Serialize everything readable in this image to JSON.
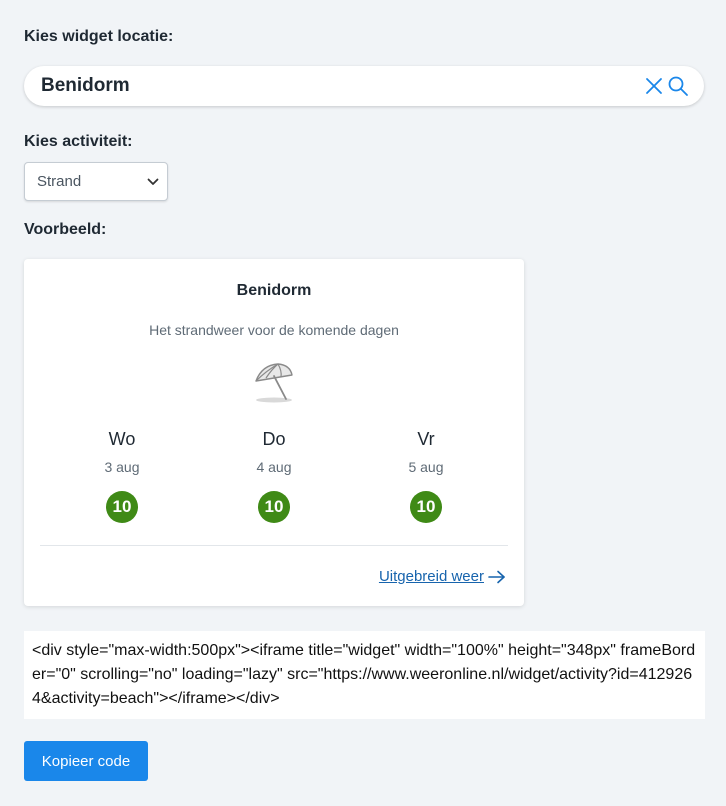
{
  "location": {
    "label": "Kies widget locatie:",
    "value": "Benidorm",
    "clear_icon": "close-icon",
    "search_icon": "search-icon",
    "accent_color": "#1a87ea"
  },
  "activity": {
    "label": "Kies activiteit:",
    "selected": "Strand",
    "dropdown_icon": "chevron-down-icon"
  },
  "preview": {
    "label": "Voorbeeld:",
    "widget": {
      "title": "Benidorm",
      "subtitle": "Het strandweer voor de komende dagen",
      "activity_icon": "beach-umbrella-icon",
      "days": [
        {
          "name": "Wo",
          "date": "3 aug",
          "score": "10"
        },
        {
          "name": "Do",
          "date": "4 aug",
          "score": "10"
        },
        {
          "name": "Vr",
          "date": "5 aug",
          "score": "10"
        }
      ],
      "score_color": "#3f8a16",
      "link_label": "Uitgebreid weer",
      "link_icon": "arrow-right-icon",
      "link_color": "#1764ad"
    }
  },
  "embed": {
    "code": "<div style=\"max-width:500px\"><iframe title=\"widget\" width=\"100%\" height=\"348px\" frameBorder=\"0\" scrolling=\"no\" loading=\"lazy\" src=\"https://www.weeronline.nl/widget/activity?id=4129264&activity=beach\"></iframe></div>",
    "copy_label": "Kopieer code",
    "button_color": "#1a87ea"
  }
}
